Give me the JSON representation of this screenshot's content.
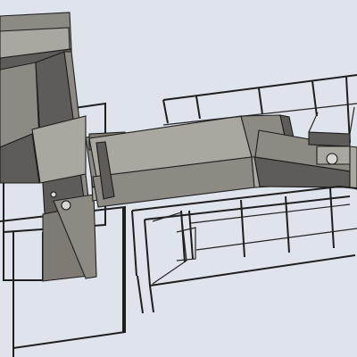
{
  "scene": {
    "kind": "cad-3d-render",
    "subject": "conveyor-machine-assembly",
    "background_color": "#dfe4ec",
    "primary_color": "#8d8a84",
    "line_color": "#1f1f1f"
  }
}
